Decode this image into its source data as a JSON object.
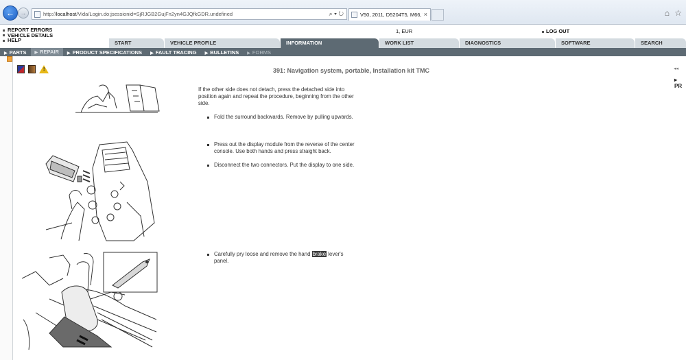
{
  "browser": {
    "url_prefix": "http://",
    "url_host": "localhost",
    "url_rest": "/Vida/Login.do;jsessionid=SjRJGB2GujFn2yn4GJQfkGDR.undefined",
    "address_tools": "⌕ ▾ ↻",
    "tab_title": "V50, 2011, D5204T5, M66, Y...",
    "tab_close": "×"
  },
  "header": {
    "links": [
      "REPORT ERRORS",
      "VEHICLE DETAILS",
      "HELP"
    ],
    "currency": "1, EUR",
    "logout": "LOG OUT"
  },
  "main_tabs": [
    "START",
    "VEHICLE PROFILE",
    "INFORMATION",
    "WORK LIST",
    "DIAGNOSTICS",
    "SOFTWARE",
    "SEARCH"
  ],
  "sub_nav": [
    "PARTS",
    "REPAIR",
    "PRODUCT SPECIFICATIONS",
    "FAULT TRACING",
    "BULLETINS",
    "FORMS"
  ],
  "document": {
    "title": "391: Navigation system, portable, Installation kit TMC",
    "right_nav": "◂◂",
    "right_label": "PR",
    "step1": "If the other side does not detach, press the detached side into position again and repeat the procedure, beginning from the other side.",
    "step2": "Fold the surround backwards. Remove by pulling upwards.",
    "step3": "Press out the display module from the reverse of the center console. Use both hands and press straight back.",
    "step4": "Disconnect the two connectors. Put the display to one side.",
    "step5_before": "Carefully pry loose and remove the hand ",
    "step5_highlight": "brake",
    "step5_after": " lever's panel."
  },
  "colors": {
    "nav_bar": "#5d6a73",
    "tab_inactive": "#d4dbe0",
    "highlight": "#3b3b3b"
  }
}
